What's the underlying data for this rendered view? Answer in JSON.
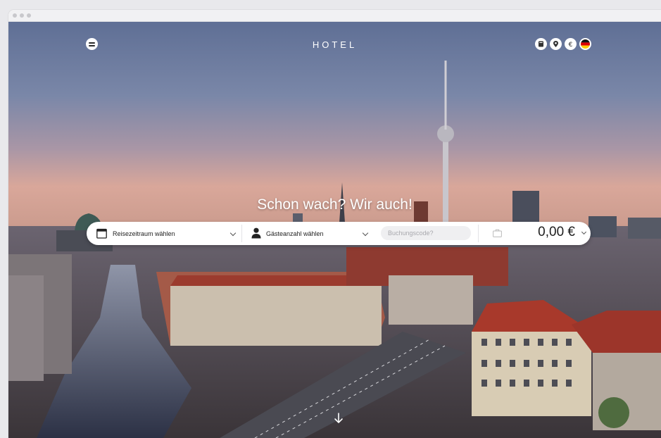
{
  "header": {
    "brand": "HOTEL",
    "menu_icon": "menu-icon",
    "icons": [
      "book-icon",
      "location-pin-icon",
      "euro-icon",
      "german-flag-icon"
    ]
  },
  "hero": {
    "headline": "Schon wach? Wir auch!"
  },
  "booking_bar": {
    "date_label": "Reisezeitraum wählen",
    "guests_label": "Gästeanzahl wählen",
    "code_placeholder": "Buchungscode?",
    "price": "0,00 €"
  },
  "colors": {
    "bar_bg": "#ffffff",
    "text_dark": "#222222",
    "input_bg": "#efeff1"
  }
}
